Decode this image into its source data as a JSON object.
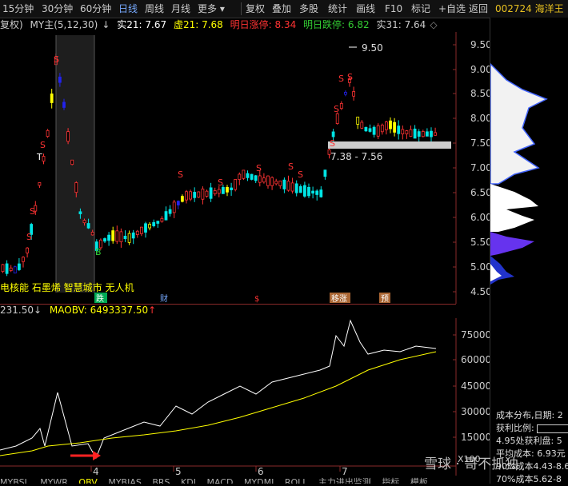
{
  "toolbar": {
    "items": [
      "15分钟",
      "30分钟",
      "60分钟",
      "日线",
      "周线",
      "月线",
      "更多",
      "复权",
      "叠加",
      "多股",
      "统计",
      "画线",
      "F10",
      "标记",
      "+自选",
      "返回"
    ],
    "active_index": 3,
    "stock_code": "002724 海洋王"
  },
  "info": {
    "rights": "复权)",
    "indicator": "MY主(5,12,30)",
    "shi21_label": "实21: 7.67",
    "xu21_label": "虚21: 7.68",
    "up_label": "明日涨停: 8.34",
    "down_label": "明日跌停: 6.82",
    "shi31_label": "实31: 7.64"
  },
  "price_axis": [
    "9.50",
    "9.00",
    "8.50",
    "8.00",
    "7.50",
    "7.00",
    "6.50",
    "6.00",
    "5.50",
    "5.00",
    "4.50"
  ],
  "max_label": "9.50",
  "range_label": "7.38 - 7.56",
  "concepts": "电核能 石墨烯 智慧城市 无人机",
  "events": [
    "跌",
    "财",
    "$",
    "移涨",
    "预"
  ],
  "signals": [
    "S",
    "S",
    "S",
    "S",
    "S",
    "B",
    "S",
    "S",
    "S",
    "S",
    "S",
    "S",
    "S",
    "S"
  ],
  "vol_axis": [
    "75000",
    "60000",
    "45000",
    "30000",
    "15000"
  ],
  "months": [
    "4",
    "5",
    "6",
    "7"
  ],
  "obv_label": "231.50",
  "maobv_label": "MAOBV: 6493337.50",
  "x100": "X100",
  "tabs": [
    "MYBSL",
    "MYWR",
    "OBV",
    "MYBIAS",
    "BRS",
    "KDJ",
    "MACD",
    "MYDMI",
    "ROLL",
    "主力进出监测",
    "指标",
    "模板"
  ],
  "chip_info": {
    "title": "成本分布,日期: 2",
    "profit": "获利比例:",
    "profit_detail": "4.95处获利盘: 5",
    "avg": "平均成本: 6.93元",
    "cost90": "90%成本4.43-8.6",
    "cost70": "70%成本5.62-8"
  },
  "watermark": "雪球 · 哥不抓独",
  "colors": {
    "up": "#ff3333",
    "down": "#00e5e5",
    "ma": "#ffff00",
    "obv": "#ffffff",
    "chip_blue": "#4466ff"
  }
}
